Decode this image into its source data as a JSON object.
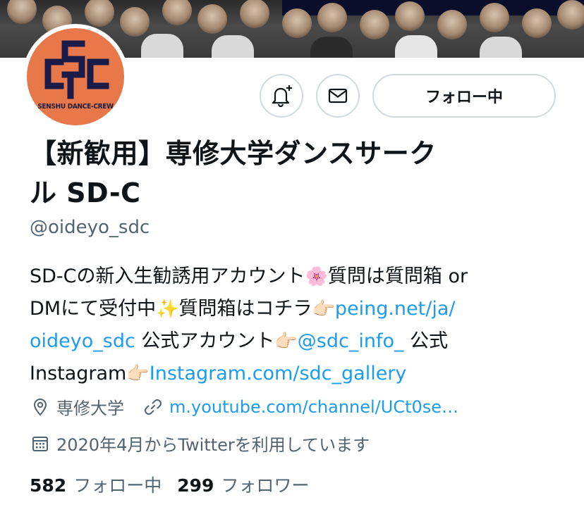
{
  "profile": {
    "avatar_text": "SENSHU DANCE-CREW",
    "display_name_line1": "【新歓用】専修大学ダンスサーク",
    "display_name_line2": "ル SD-C",
    "handle": "@oideyo_sdc"
  },
  "actions": {
    "notify_icon": "bell-plus-icon",
    "message_icon": "mail-icon",
    "follow_label": "フォロー中"
  },
  "bio": {
    "line1_text": "SD-Cの新入生勧誘用アカウント",
    "line1_emoji": "🌸",
    "line1_text2": "質問は質問箱 or",
    "line2_text": "DMにて受付中",
    "line2_emoji": "✨",
    "line2_text2": "質問箱はコチラ",
    "line2_emoji2": "👉🏻",
    "line2_link": "peing.net/ja/",
    "line3_link": "oideyo_sdc",
    "line3_text": " 公式アカウント",
    "line3_emoji": "👉🏻",
    "line3_mention": "@sdc_info_",
    "line3_text2": " 公式",
    "line4_text": "Instagram",
    "line4_emoji": "👉🏻",
    "line4_link": "Instagram.com/sdc_gallery"
  },
  "meta": {
    "location_icon": "location-pin-icon",
    "location": "専修大学",
    "link_icon": "link-icon",
    "website": "m.youtube.com/channel/UCt0se…",
    "calendar_icon": "calendar-icon",
    "joined": "2020年4月からTwitterを利用しています"
  },
  "stats": {
    "following_count": "582",
    "following_label": "フォロー中",
    "followers_count": "299",
    "followers_label": "フォロワー"
  }
}
